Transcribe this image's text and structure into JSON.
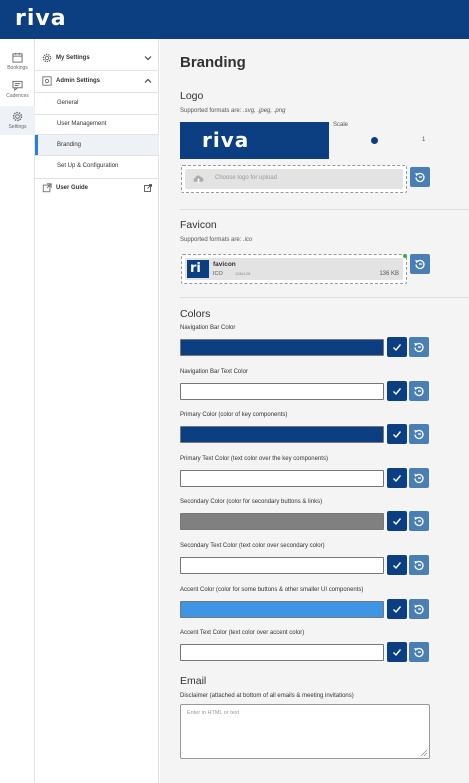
{
  "app": {
    "brand": "riva"
  },
  "rail": [
    {
      "label": "Bookings",
      "icon": "calendar-icon"
    },
    {
      "label": "Cadences",
      "icon": "chat-icon"
    },
    {
      "label": "Settings",
      "icon": "gear-icon"
    }
  ],
  "nav": {
    "my_settings": "My Settings",
    "admin_settings": "Admin Settings",
    "items": [
      "General",
      "User Management",
      "Branding",
      "Set Up & Configuration"
    ],
    "user_guide": "User Guide"
  },
  "page": {
    "title": "Branding",
    "logo": {
      "title": "Logo",
      "formats_label": "Supported formats are: ",
      "formats": ".svg, .jpeg, .png",
      "preview_text": "riva",
      "scale_label": "Scale",
      "scale_value": "1",
      "upload_placeholder": "Choose logo for upload"
    },
    "favicon": {
      "title": "Favicon",
      "formats_label": "Supported formats are: ",
      "formats": ".ico",
      "thumb_text": "ri",
      "file_name": "favicon",
      "file_type": "ICO",
      "dimensions": "128x128",
      "file_size": "136 KB"
    },
    "colors": {
      "title": "Colors",
      "fields": [
        {
          "label": "Navigation Bar Color",
          "value": "#0b3f82"
        },
        {
          "label": "Navigation Bar Text Color",
          "value": "#ffffff"
        },
        {
          "label": "Primary Color (color of key components)",
          "value": "#0b3f82"
        },
        {
          "label": "Primary Text Color (text color over the key components)",
          "value": "#ffffff"
        },
        {
          "label": "Secondary Color (color for secondary buttons & links)",
          "value": "#808080"
        },
        {
          "label": "Secondary Text Color (text color over secondary color)",
          "value": "#ffffff"
        },
        {
          "label": "Accent Color (color for some buttons & other smaller UI components)",
          "value": "#3d95e3"
        },
        {
          "label": "Accent Text Color (text color over accent color)",
          "value": "#ffffff"
        }
      ]
    },
    "email": {
      "title": "Email",
      "disclaimer_label": "Disclaimer (attached at bottom of all emails & meeting invitations)",
      "disclaimer_placeholder": "Enter in HTML or text"
    }
  },
  "colors": {
    "brand": "#0b3f82",
    "reset_button": "#4a7fb5",
    "active_nav": "#2d7be6"
  }
}
